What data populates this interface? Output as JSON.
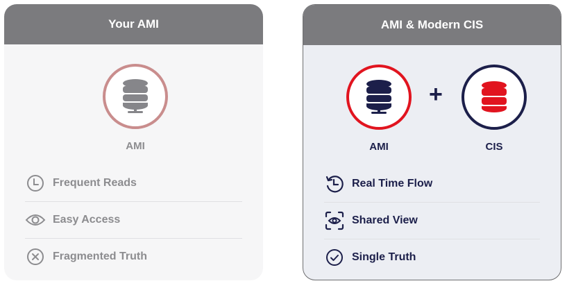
{
  "left_card": {
    "title": "Your AMI",
    "circle_label": "AMI",
    "items": [
      {
        "label": "Frequent Reads",
        "icon": "clock-icon"
      },
      {
        "label": "Easy Access",
        "icon": "eye-icon"
      },
      {
        "label": "Fragmented Truth",
        "icon": "x-circle-icon"
      }
    ]
  },
  "right_card": {
    "title": "AMI & Modern CIS",
    "plus": "+",
    "circle_labels": [
      "AMI",
      "CIS"
    ],
    "items": [
      {
        "label": "Real Time Flow",
        "icon": "clock-refresh-icon"
      },
      {
        "label": "Shared View",
        "icon": "focus-eye-icon"
      },
      {
        "label": "Single Truth",
        "icon": "check-circle-icon"
      }
    ]
  },
  "colors": {
    "header_bg": "#7b7b7e",
    "navy": "#1c1f4a",
    "red": "#e1141f",
    "muted_pink": "#c98d8d",
    "grey_text": "#8c8c8f"
  }
}
